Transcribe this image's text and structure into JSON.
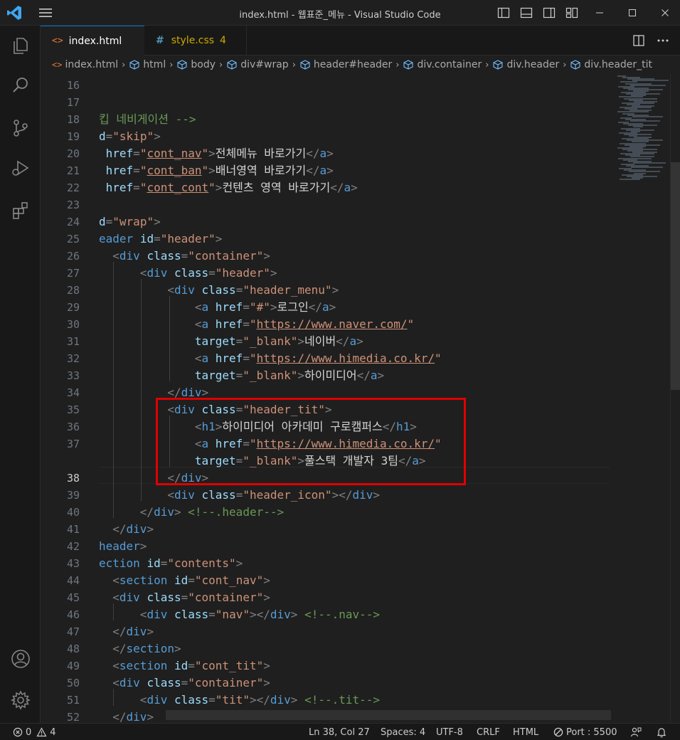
{
  "window": {
    "title": "index.html - 웹표준_메뉴 - Visual Studio Code"
  },
  "tabs": [
    {
      "label": "index.html",
      "icon": "html-icon",
      "active": true
    },
    {
      "label": "style.css",
      "badge": "4",
      "icon": "css-icon",
      "active": false
    }
  ],
  "breadcrumb": [
    "index.html",
    "html",
    "body",
    "div#wrap",
    "header#header",
    "div.container",
    "div.header",
    "div.header_tit"
  ],
  "editor": {
    "cursor_line": 38,
    "lines": [
      {
        "n": "16",
        "tokens": []
      },
      {
        "n": "17",
        "tokens": []
      },
      {
        "n": "18",
        "tokens": [
          [
            "com",
            "킵 네비게이션 -->"
          ]
        ]
      },
      {
        "n": "19",
        "tokens": [
          [
            "attr",
            "d"
          ],
          [
            "punc",
            "="
          ],
          [
            "str",
            "\"skip\""
          ],
          [
            "punc",
            ">"
          ]
        ]
      },
      {
        "n": "20",
        "tokens": [
          [
            "text",
            " "
          ],
          [
            "attr",
            "href"
          ],
          [
            "punc",
            "="
          ],
          [
            "str",
            "\""
          ],
          [
            "url",
            "cont_nav"
          ],
          [
            "str",
            "\""
          ],
          [
            "punc",
            ">"
          ],
          [
            "text",
            "전체메뉴 바로가기"
          ],
          [
            "punc",
            "</"
          ],
          [
            "tag",
            "a"
          ],
          [
            "punc",
            ">"
          ]
        ]
      },
      {
        "n": "21",
        "tokens": [
          [
            "text",
            " "
          ],
          [
            "attr",
            "href"
          ],
          [
            "punc",
            "="
          ],
          [
            "str",
            "\""
          ],
          [
            "url",
            "cont_ban"
          ],
          [
            "str",
            "\""
          ],
          [
            "punc",
            ">"
          ],
          [
            "text",
            "배너영역 바로가기"
          ],
          [
            "punc",
            "</"
          ],
          [
            "tag",
            "a"
          ],
          [
            "punc",
            ">"
          ]
        ]
      },
      {
        "n": "22",
        "tokens": [
          [
            "text",
            " "
          ],
          [
            "attr",
            "href"
          ],
          [
            "punc",
            "="
          ],
          [
            "str",
            "\""
          ],
          [
            "url",
            "cont_cont"
          ],
          [
            "str",
            "\""
          ],
          [
            "punc",
            ">"
          ],
          [
            "text",
            "컨텐츠 영역 바로가기"
          ],
          [
            "punc",
            "</"
          ],
          [
            "tag",
            "a"
          ],
          [
            "punc",
            ">"
          ]
        ]
      },
      {
        "n": "23",
        "tokens": []
      },
      {
        "n": "24",
        "tokens": [
          [
            "attr",
            "d"
          ],
          [
            "punc",
            "="
          ],
          [
            "str",
            "\"wrap\""
          ],
          [
            "punc",
            ">"
          ]
        ]
      },
      {
        "n": "25",
        "tokens": [
          [
            "tag",
            "eader"
          ],
          [
            "text",
            " "
          ],
          [
            "attr",
            "id"
          ],
          [
            "punc",
            "="
          ],
          [
            "str",
            "\"header\""
          ],
          [
            "punc",
            ">"
          ]
        ]
      },
      {
        "n": "26",
        "tokens": [
          [
            "text",
            "  "
          ],
          [
            "punc",
            "<"
          ],
          [
            "tag",
            "div"
          ],
          [
            "text",
            " "
          ],
          [
            "attr",
            "class"
          ],
          [
            "punc",
            "="
          ],
          [
            "str",
            "\"container\""
          ],
          [
            "punc",
            ">"
          ]
        ]
      },
      {
        "n": "27",
        "tokens": [
          [
            "text",
            "      "
          ],
          [
            "punc",
            "<"
          ],
          [
            "tag",
            "div"
          ],
          [
            "text",
            " "
          ],
          [
            "attr",
            "class"
          ],
          [
            "punc",
            "="
          ],
          [
            "str",
            "\"header\""
          ],
          [
            "punc",
            ">"
          ]
        ]
      },
      {
        "n": "28",
        "tokens": [
          [
            "text",
            "          "
          ],
          [
            "punc",
            "<"
          ],
          [
            "tag",
            "div"
          ],
          [
            "text",
            " "
          ],
          [
            "attr",
            "class"
          ],
          [
            "punc",
            "="
          ],
          [
            "str",
            "\"header_menu\""
          ],
          [
            "punc",
            ">"
          ]
        ]
      },
      {
        "n": "29",
        "tokens": [
          [
            "text",
            "              "
          ],
          [
            "punc",
            "<"
          ],
          [
            "tag",
            "a"
          ],
          [
            "text",
            " "
          ],
          [
            "attr",
            "href"
          ],
          [
            "punc",
            "="
          ],
          [
            "str",
            "\"#\""
          ],
          [
            "punc",
            ">"
          ],
          [
            "text",
            "로그인"
          ],
          [
            "punc",
            "</"
          ],
          [
            "tag",
            "a"
          ],
          [
            "punc",
            ">"
          ]
        ]
      },
      {
        "n": "30",
        "tokens": [
          [
            "text",
            "              "
          ],
          [
            "punc",
            "<"
          ],
          [
            "tag",
            "a"
          ],
          [
            "text",
            " "
          ],
          [
            "attr",
            "href"
          ],
          [
            "punc",
            "="
          ],
          [
            "str",
            "\""
          ],
          [
            "url",
            "https://www.naver.com/"
          ],
          [
            "str",
            "\""
          ]
        ]
      },
      {
        "n": "31",
        "tokens": [
          [
            "text",
            "              "
          ],
          [
            "attr",
            "target"
          ],
          [
            "punc",
            "="
          ],
          [
            "str",
            "\"_blank\""
          ],
          [
            "punc",
            ">"
          ],
          [
            "text",
            "네이버"
          ],
          [
            "punc",
            "</"
          ],
          [
            "tag",
            "a"
          ],
          [
            "punc",
            ">"
          ]
        ]
      },
      {
        "n": "32",
        "tokens": [
          [
            "text",
            "              "
          ],
          [
            "punc",
            "<"
          ],
          [
            "tag",
            "a"
          ],
          [
            "text",
            " "
          ],
          [
            "attr",
            "href"
          ],
          [
            "punc",
            "="
          ],
          [
            "str",
            "\""
          ],
          [
            "url",
            "https://www.himedia.co.kr/"
          ],
          [
            "str",
            "\""
          ]
        ]
      },
      {
        "n": "33",
        "tokens": [
          [
            "text",
            "              "
          ],
          [
            "attr",
            "target"
          ],
          [
            "punc",
            "="
          ],
          [
            "str",
            "\"_blank\""
          ],
          [
            "punc",
            ">"
          ],
          [
            "text",
            "하이미디어"
          ],
          [
            "punc",
            "</"
          ],
          [
            "tag",
            "a"
          ],
          [
            "punc",
            ">"
          ]
        ]
      },
      {
        "n": "34",
        "tokens": [
          [
            "text",
            "          "
          ],
          [
            "punc",
            "</"
          ],
          [
            "tag",
            "div"
          ],
          [
            "punc",
            ">"
          ]
        ]
      },
      {
        "n": "35",
        "tokens": [
          [
            "text",
            "          "
          ],
          [
            "punc",
            "<"
          ],
          [
            "tag",
            "div"
          ],
          [
            "text",
            " "
          ],
          [
            "attr",
            "class"
          ],
          [
            "punc",
            "="
          ],
          [
            "str",
            "\"header_tit\""
          ],
          [
            "punc",
            ">"
          ]
        ]
      },
      {
        "n": "36",
        "tokens": [
          [
            "text",
            "              "
          ],
          [
            "punc",
            "<"
          ],
          [
            "tag",
            "h1"
          ],
          [
            "punc",
            ">"
          ],
          [
            "text",
            "하이미디어 아카데미 구로캠퍼스"
          ],
          [
            "punc",
            "</"
          ],
          [
            "tag",
            "h1"
          ],
          [
            "punc",
            ">"
          ]
        ]
      },
      {
        "n": "37",
        "tokens": [
          [
            "text",
            "              "
          ],
          [
            "punc",
            "<"
          ],
          [
            "tag",
            "a"
          ],
          [
            "text",
            " "
          ],
          [
            "attr",
            "href"
          ],
          [
            "punc",
            "="
          ],
          [
            "str",
            "\""
          ],
          [
            "url",
            "https://www.himedia.co.kr/"
          ],
          [
            "str",
            "\""
          ]
        ]
      },
      {
        "n": "",
        "tokens": [
          [
            "text",
            "              "
          ],
          [
            "attr",
            "target"
          ],
          [
            "punc",
            "="
          ],
          [
            "str",
            "\"_blank\""
          ],
          [
            "punc",
            ">"
          ],
          [
            "text",
            "풀스택 개발자 3팀"
          ],
          [
            "punc",
            "</"
          ],
          [
            "tag",
            "a"
          ],
          [
            "punc",
            ">"
          ]
        ]
      },
      {
        "n": "38",
        "tokens": [
          [
            "text",
            "          "
          ],
          [
            "punc",
            "</"
          ],
          [
            "tag",
            "div"
          ],
          [
            "punc",
            ">"
          ]
        ]
      },
      {
        "n": "39",
        "tokens": [
          [
            "text",
            "          "
          ],
          [
            "punc",
            "<"
          ],
          [
            "tag",
            "div"
          ],
          [
            "text",
            " "
          ],
          [
            "attr",
            "class"
          ],
          [
            "punc",
            "="
          ],
          [
            "str",
            "\"header_icon\""
          ],
          [
            "punc",
            "></"
          ],
          [
            "tag",
            "div"
          ],
          [
            "punc",
            ">"
          ]
        ]
      },
      {
        "n": "40",
        "tokens": [
          [
            "text",
            "      "
          ],
          [
            "punc",
            "</"
          ],
          [
            "tag",
            "div"
          ],
          [
            "punc",
            ">"
          ],
          [
            "text",
            " "
          ],
          [
            "com",
            "<!--.header-->"
          ]
        ]
      },
      {
        "n": "41",
        "tokens": [
          [
            "text",
            "  "
          ],
          [
            "punc",
            "</"
          ],
          [
            "tag",
            "div"
          ],
          [
            "punc",
            ">"
          ]
        ]
      },
      {
        "n": "42",
        "tokens": [
          [
            "tag",
            "header"
          ],
          [
            "punc",
            ">"
          ]
        ]
      },
      {
        "n": "43",
        "tokens": [
          [
            "tag",
            "ection"
          ],
          [
            "text",
            " "
          ],
          [
            "attr",
            "id"
          ],
          [
            "punc",
            "="
          ],
          [
            "str",
            "\"contents\""
          ],
          [
            "punc",
            ">"
          ]
        ]
      },
      {
        "n": "44",
        "tokens": [
          [
            "text",
            "  "
          ],
          [
            "punc",
            "<"
          ],
          [
            "tag",
            "section"
          ],
          [
            "text",
            " "
          ],
          [
            "attr",
            "id"
          ],
          [
            "punc",
            "="
          ],
          [
            "str",
            "\"cont_nav\""
          ],
          [
            "punc",
            ">"
          ]
        ]
      },
      {
        "n": "45",
        "tokens": [
          [
            "text",
            "  "
          ],
          [
            "punc",
            "<"
          ],
          [
            "tag",
            "div"
          ],
          [
            "text",
            " "
          ],
          [
            "attr",
            "class"
          ],
          [
            "punc",
            "="
          ],
          [
            "str",
            "\"container\""
          ],
          [
            "punc",
            ">"
          ]
        ]
      },
      {
        "n": "46",
        "tokens": [
          [
            "text",
            "      "
          ],
          [
            "punc",
            "<"
          ],
          [
            "tag",
            "div"
          ],
          [
            "text",
            " "
          ],
          [
            "attr",
            "class"
          ],
          [
            "punc",
            "="
          ],
          [
            "str",
            "\"nav\""
          ],
          [
            "punc",
            "></"
          ],
          [
            "tag",
            "div"
          ],
          [
            "punc",
            ">"
          ],
          [
            "text",
            " "
          ],
          [
            "com",
            "<!--.nav-->"
          ]
        ]
      },
      {
        "n": "47",
        "tokens": [
          [
            "text",
            "  "
          ],
          [
            "punc",
            "</"
          ],
          [
            "tag",
            "div"
          ],
          [
            "punc",
            ">"
          ]
        ]
      },
      {
        "n": "48",
        "tokens": [
          [
            "text",
            "  "
          ],
          [
            "punc",
            "</"
          ],
          [
            "tag",
            "section"
          ],
          [
            "punc",
            ">"
          ]
        ]
      },
      {
        "n": "49",
        "tokens": [
          [
            "text",
            "  "
          ],
          [
            "punc",
            "<"
          ],
          [
            "tag",
            "section"
          ],
          [
            "text",
            " "
          ],
          [
            "attr",
            "id"
          ],
          [
            "punc",
            "="
          ],
          [
            "str",
            "\"cont_tit\""
          ],
          [
            "punc",
            ">"
          ]
        ]
      },
      {
        "n": "50",
        "tokens": [
          [
            "text",
            "  "
          ],
          [
            "punc",
            "<"
          ],
          [
            "tag",
            "div"
          ],
          [
            "text",
            " "
          ],
          [
            "attr",
            "class"
          ],
          [
            "punc",
            "="
          ],
          [
            "str",
            "\"container\""
          ],
          [
            "punc",
            ">"
          ]
        ]
      },
      {
        "n": "51",
        "tokens": [
          [
            "text",
            "      "
          ],
          [
            "punc",
            "<"
          ],
          [
            "tag",
            "div"
          ],
          [
            "text",
            " "
          ],
          [
            "attr",
            "class"
          ],
          [
            "punc",
            "="
          ],
          [
            "str",
            "\"tit\""
          ],
          [
            "punc",
            "></"
          ],
          [
            "tag",
            "div"
          ],
          [
            "punc",
            ">"
          ],
          [
            "text",
            " "
          ],
          [
            "com",
            "<!--.tit-->"
          ]
        ]
      },
      {
        "n": "52",
        "tokens": [
          [
            "text",
            "  "
          ],
          [
            "punc",
            "</"
          ],
          [
            "tag",
            "div"
          ],
          [
            "punc",
            ">"
          ]
        ]
      }
    ]
  },
  "statusbar": {
    "errors": "0",
    "warnings": "4",
    "position": "Ln 38, Col 27",
    "spaces": "Spaces: 4",
    "encoding": "UTF-8",
    "eol": "CRLF",
    "language": "HTML",
    "port": "Port : 5500"
  },
  "colors": {
    "accent": "#0078d4",
    "highlight_box": "#e00000",
    "tag": "#569cd6",
    "attribute": "#9cdcfe",
    "string": "#ce9178",
    "comment": "#6a9955"
  }
}
